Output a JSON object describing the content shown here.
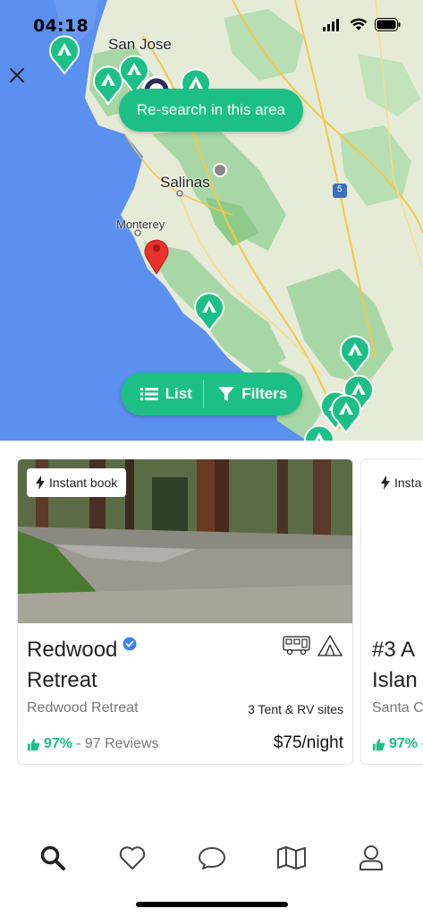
{
  "status_bar": {
    "time": "04:18"
  },
  "map": {
    "research_label": "Re-search in this area",
    "city_labels": [
      "San Jose",
      "Salinas",
      "Monterey"
    ],
    "highway_label": "5",
    "list_label": "List",
    "filters_label": "Filters"
  },
  "cards": [
    {
      "badge": "Instant book",
      "title_line1": "Redwood",
      "title_line2": "Retreat",
      "subtitle": "Redwood Retreat",
      "sites": "3 Tent & RV sites",
      "rating_pct": "97%",
      "reviews": "- 97 Reviews",
      "price": "$75/night"
    },
    {
      "badge": "Insta",
      "title_line1": "#3 A",
      "title_line2": "Islan",
      "subtitle": "Santa C",
      "rating_pct": "97%",
      "reviews": "-"
    }
  ],
  "tabbar": {
    "items": [
      "search-icon",
      "heart-icon",
      "chat-icon",
      "map-icon",
      "profile-icon"
    ]
  },
  "colors": {
    "accent": "#1cc086",
    "water": "#5b8ff0",
    "land_green": "#a7d7a6",
    "pin_red": "#e8322c"
  }
}
